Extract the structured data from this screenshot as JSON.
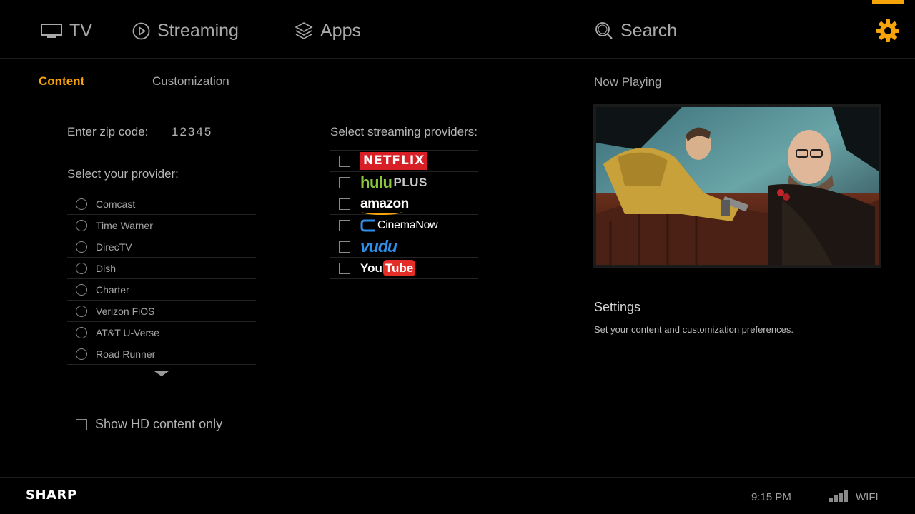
{
  "nav": {
    "tv_label": "TV",
    "streaming_label": "Streaming",
    "apps_label": "Apps",
    "search_label": "Search",
    "accent_color": "#f7a30a"
  },
  "tabs": {
    "content": "Content",
    "customization": "Customization",
    "active": "Content"
  },
  "zip": {
    "label": "Enter zip code:",
    "value": "12345"
  },
  "providers": {
    "title": "Select your provider:",
    "items": [
      {
        "label": "Comcast",
        "selected": false
      },
      {
        "label": "Time Warner",
        "selected": false
      },
      {
        "label": "DirecTV",
        "selected": false
      },
      {
        "label": "Dish",
        "selected": false
      },
      {
        "label": "Charter",
        "selected": false
      },
      {
        "label": "Verizon FiOS",
        "selected": false
      },
      {
        "label": "AT&T U-Verse",
        "selected": false
      },
      {
        "label": "Road Runner",
        "selected": false
      }
    ]
  },
  "hd_only": {
    "label": "Show HD content only",
    "checked": false
  },
  "streaming": {
    "title": "Select streaming providers:",
    "items": [
      {
        "logo": "NETFLIX",
        "checked": false
      },
      {
        "logo": "hulu",
        "logo_suffix": "PLUS",
        "checked": false
      },
      {
        "logo": "amazon",
        "checked": false
      },
      {
        "logo": "CinemaNow",
        "checked": false
      },
      {
        "logo": "vudu",
        "checked": false
      },
      {
        "logo": "You",
        "logo_suffix": "Tube",
        "checked": false
      }
    ]
  },
  "now_playing": {
    "title": "Now Playing"
  },
  "settings_info": {
    "title": "Settings",
    "description": "Set your content and customization preferences."
  },
  "footer": {
    "brand": "SHARP",
    "time": "9:15 PM",
    "network": "WIFI"
  }
}
